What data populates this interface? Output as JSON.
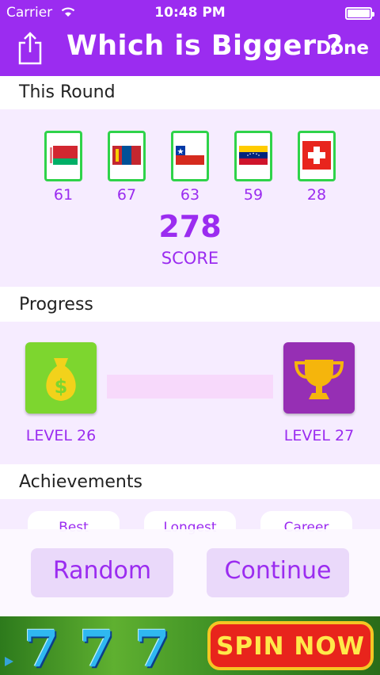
{
  "status": {
    "carrier": "Carrier",
    "time": "10:48 PM"
  },
  "nav": {
    "title": "Which is Bigger ?",
    "done": "Done"
  },
  "sections": {
    "round": "This Round",
    "progress": "Progress",
    "achievements": "Achievements"
  },
  "round": {
    "flags": [
      {
        "country": "Belarus",
        "value": "61"
      },
      {
        "country": "Mongolia",
        "value": "67"
      },
      {
        "country": "Chile",
        "value": "63"
      },
      {
        "country": "Venezuela",
        "value": "59"
      },
      {
        "country": "Switzerland",
        "value": "28"
      }
    ],
    "score_value": "278",
    "score_label": "SCORE"
  },
  "progress": {
    "current_level": "LEVEL 26",
    "next_level": "LEVEL 27",
    "fill_fraction": 0
  },
  "achievements": {
    "chips": [
      "Best",
      "Longest",
      "Career"
    ]
  },
  "buttons": {
    "random": "Random",
    "continue": "Continue"
  },
  "ad": {
    "sevens": [
      "7",
      "7",
      "7"
    ],
    "cta": "SPIN NOW"
  },
  "colors": {
    "accent": "#9b2cf0",
    "panel": "#f6ecff",
    "flag_border": "#2fd34a"
  }
}
